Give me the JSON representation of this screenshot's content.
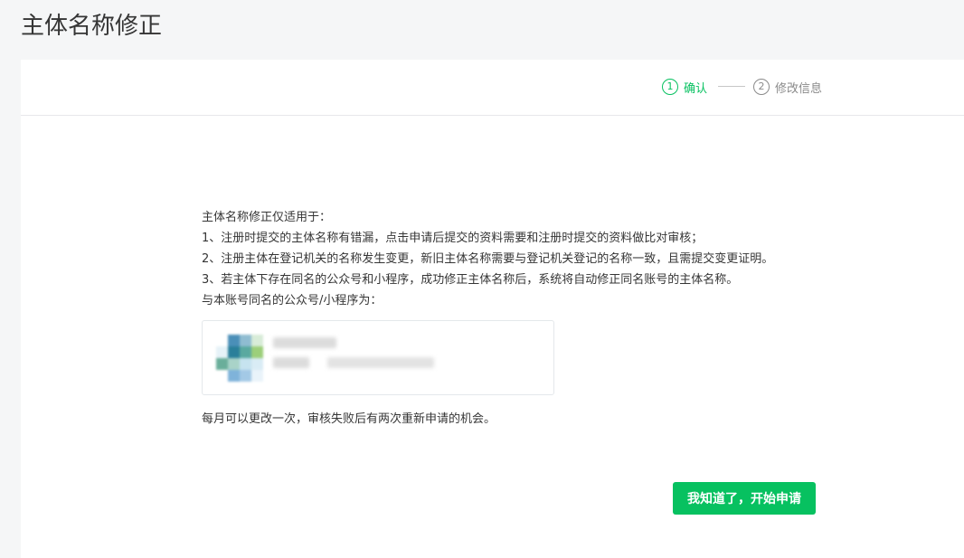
{
  "page": {
    "title": "主体名称修正"
  },
  "steps": [
    {
      "num": "1",
      "label": "确认",
      "active": true
    },
    {
      "num": "2",
      "label": "修改信息",
      "active": false
    }
  ],
  "info": {
    "heading": "主体名称修正仅适用于：",
    "rules": [
      "1、注册时提交的主体名称有错漏，点击申请后提交的资料需要和注册时提交的资料做比对审核；",
      "2、注册主体在登记机关的名称发生变更，新旧主体名称需要与登记机关登记的名称一致，且需提交变更证明。",
      "3、若主体下存在同名的公众号和小程序，成功修正主体名称后，系统将自动修正同名账号的主体名称。"
    ],
    "same_name_label": "与本账号同名的公众号/小程序为："
  },
  "note": "每月可以更改一次，审核失败后有两次重新申请的机会。",
  "button": {
    "label": "我知道了，开始申请"
  },
  "colors": {
    "accent": "#07c160",
    "arrow": "#e8312a",
    "text": "#353535",
    "muted": "#8a8a8a"
  },
  "icons": {
    "annotation_arrow": "arrow-right-icon",
    "avatar": "mosaic-avatar"
  }
}
